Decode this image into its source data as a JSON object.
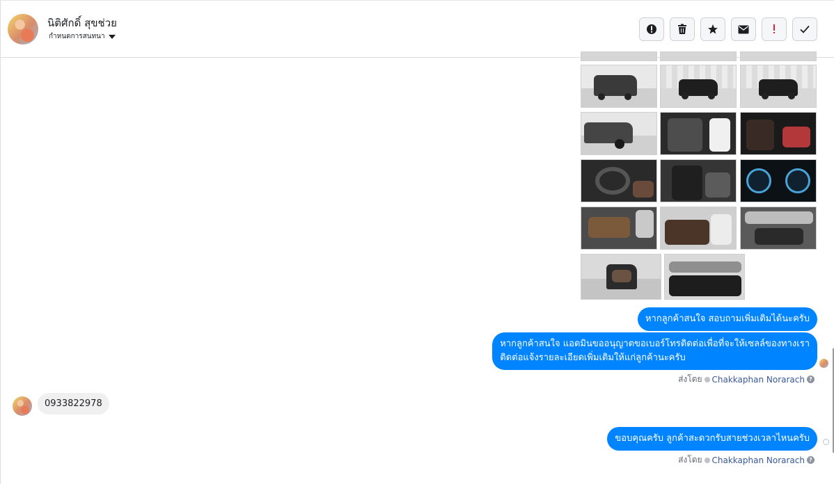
{
  "header": {
    "contact_name": "นิติศักดิ์ สุขช่วย",
    "subtitle": "กำหนดการสนทนา",
    "actions": [
      {
        "name": "spam",
        "icon": "alert-circle-icon"
      },
      {
        "name": "delete",
        "icon": "trash-icon"
      },
      {
        "name": "star",
        "icon": "star-icon"
      },
      {
        "name": "mark-unread",
        "icon": "envelope-icon"
      },
      {
        "name": "important",
        "icon": "exclamation-icon"
      },
      {
        "name": "done",
        "icon": "checkmark-icon"
      }
    ],
    "colors": {
      "important": "#e41e3f",
      "icon": "#1c1e21"
    }
  },
  "messages": [
    {
      "type": "outgoing",
      "text": "หากลูกค้าสนใจ สอบถามเพิ่มเติมได้นะครับ"
    },
    {
      "type": "outgoing",
      "lines": [
        "หากลูกค้าสนใจ แอดมินขออนุญาตขอเบอร์โทรติดต่อเพื่อที่จะให้เซลล์ของทางเรา",
        "ติดต่อแจ้งรายละเอียดเพิ่มเติมให้แก่ลูกค้านะครับ"
      ]
    },
    {
      "type": "incoming",
      "text": "0933822978"
    },
    {
      "type": "outgoing",
      "text": "ขอบคุณครับ ลูกค้าสะดวกรับสายช่วงเวลาไหนครับ"
    }
  ],
  "sent_by": {
    "label": "ส่งโดย",
    "name": "Chakkaphan Norarach",
    "help": "?"
  },
  "photos": {
    "count": 14,
    "accent": "#0084ff"
  }
}
